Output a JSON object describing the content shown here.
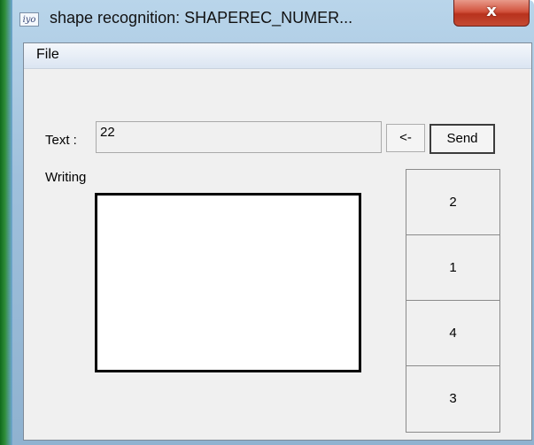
{
  "window": {
    "title": "shape recognition: SHAPEREC_NUMER...",
    "close_glyph": "x",
    "app_icon": "app-icon",
    "app_icon_glyph": "iyo"
  },
  "menubar": {
    "file_label": "File"
  },
  "input_row": {
    "text_label": "Text :",
    "text_value": "22",
    "back_label": "<-",
    "send_label": "Send"
  },
  "writing": {
    "label": "Writing"
  },
  "candidates": [
    "2",
    "1",
    "4",
    "3"
  ],
  "colors": {
    "close_button": "#c44a33",
    "titlebar": "#9fc0dc",
    "client_bg": "#f0f0f0",
    "left_accent": "#2f8d3a"
  }
}
